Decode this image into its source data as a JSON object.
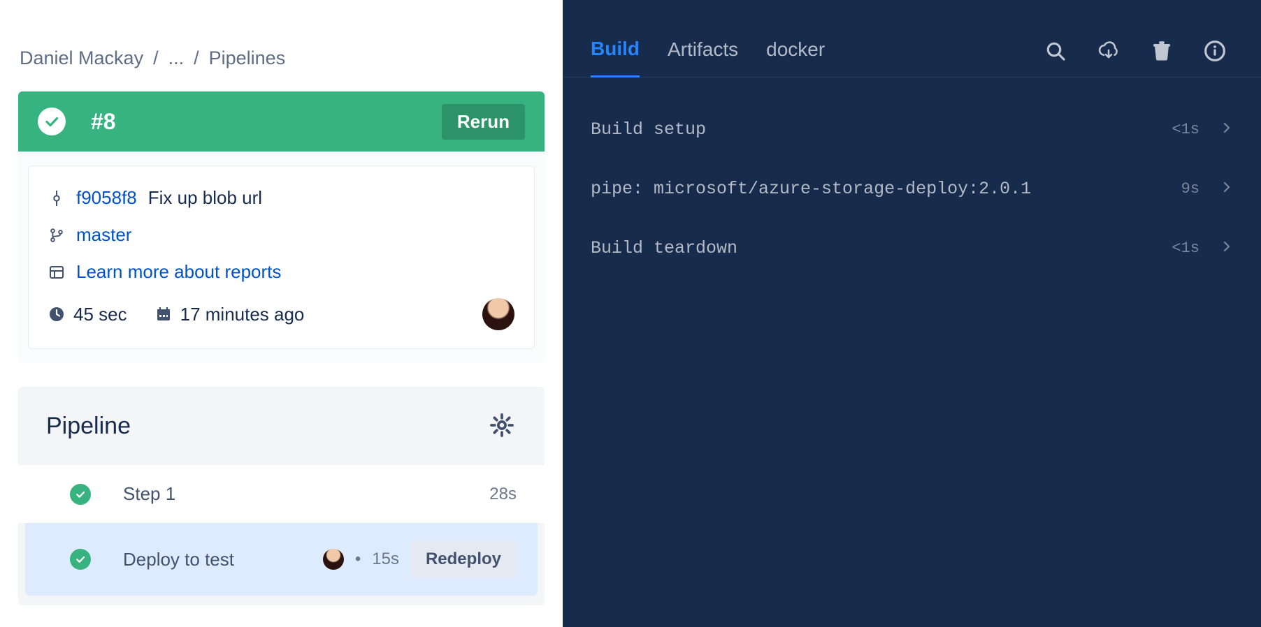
{
  "breadcrumb": {
    "owner": "Daniel Mackay",
    "ellipsis": "...",
    "page": "Pipelines"
  },
  "run": {
    "number": "#8",
    "rerun_label": "Rerun",
    "commit_hash": "f9058f8",
    "commit_msg": "Fix up blob url",
    "branch": "master",
    "reports_link": "Learn more about reports",
    "duration": "45 sec",
    "when": "17 minutes ago"
  },
  "pipeline": {
    "title": "Pipeline",
    "steps": [
      {
        "label": "Step 1",
        "time": "28s"
      },
      {
        "label": "Deploy to test",
        "time": "15s",
        "redeploy": "Redeploy"
      }
    ]
  },
  "tabs": {
    "build": "Build",
    "artifacts": "Artifacts",
    "docker": "docker"
  },
  "logs": [
    {
      "label": "Build setup",
      "time": "<1s"
    },
    {
      "label": "pipe: microsoft/azure-storage-deploy:2.0.1",
      "time": "9s"
    },
    {
      "label": "Build teardown",
      "time": "<1s"
    }
  ]
}
